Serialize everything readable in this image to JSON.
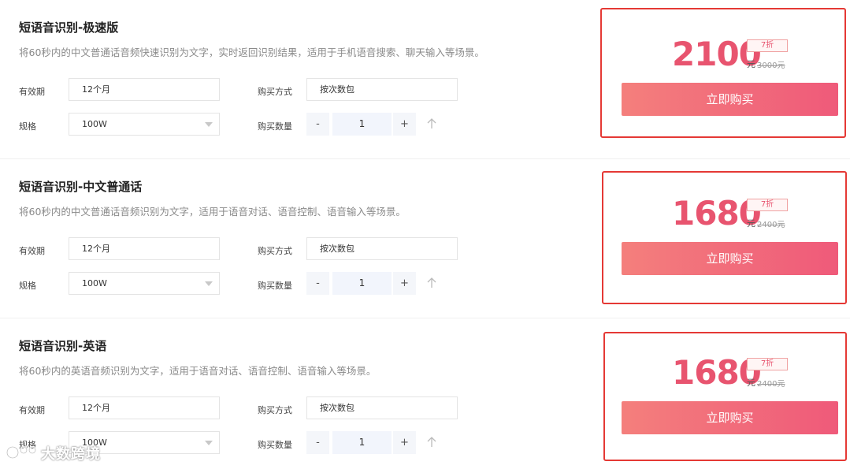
{
  "cards": [
    {
      "title": "短语音识别-极速版",
      "description": "将60秒内的中文普通话音频快速识别为文字，实时返回识别结果，适用于手机语音搜索、聊天输入等场景。",
      "validity_label": "有效期",
      "validity_value": "12个月",
      "purchase_method_label": "购买方式",
      "purchase_method_value": "按次数包",
      "spec_label": "规格",
      "spec_value": "100W",
      "quantity_label": "购买数量",
      "quantity_minus": "-",
      "quantity_value": "1",
      "quantity_plus": "+",
      "price": "2100",
      "currency": "元",
      "original_price": "3000元",
      "discount": "7折",
      "buy_label": "立即购买"
    },
    {
      "title": "短语音识别-中文普通话",
      "description": "将60秒内的中文普通话音频识别为文字，适用于语音对话、语音控制、语音输入等场景。",
      "validity_label": "有效期",
      "validity_value": "12个月",
      "purchase_method_label": "购买方式",
      "purchase_method_value": "按次数包",
      "spec_label": "规格",
      "spec_value": "100W",
      "quantity_label": "购买数量",
      "quantity_minus": "-",
      "quantity_value": "1",
      "quantity_plus": "+",
      "price": "1680",
      "currency": "元",
      "original_price": "2400元",
      "discount": "7折",
      "buy_label": "立即购买"
    },
    {
      "title": "短语音识别-英语",
      "description": "将60秒内的英语音频识别为文字，适用于语音对话、语音控制、语音输入等场景。",
      "validity_label": "有效期",
      "validity_value": "12个月",
      "purchase_method_label": "购买方式",
      "purchase_method_value": "按次数包",
      "spec_label": "规格",
      "spec_value": "100W",
      "quantity_label": "购买数量",
      "quantity_minus": "-",
      "quantity_value": "1",
      "quantity_plus": "+",
      "price": "1680",
      "currency": "元",
      "original_price": "2400元",
      "discount": "7折",
      "buy_label": "立即购买"
    }
  ],
  "watermark": "大数跨境",
  "colors": {
    "accent": "#e8546f",
    "highlight_border": "#e53935",
    "button_gradient_start": "#f47f7c",
    "button_gradient_end": "#ef5a7a"
  }
}
